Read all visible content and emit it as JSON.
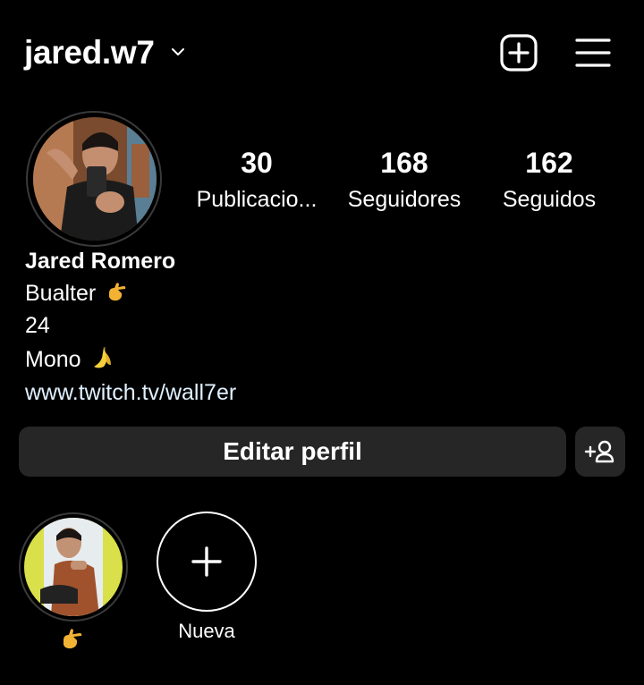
{
  "header": {
    "username": "jared.w7",
    "icons": [
      "chevron-down-icon",
      "plus-square-icon",
      "hamburger-menu-icon"
    ]
  },
  "stats": {
    "posts": {
      "value": "30",
      "label": "Publicacio..."
    },
    "followers": {
      "value": "168",
      "label": "Seguidores"
    },
    "following": {
      "value": "162",
      "label": "Seguidos"
    }
  },
  "profile": {
    "full_name": "Jared Romero",
    "bio_line1": "Bualter",
    "bio_line1_emoji": "pointing-hand-emoji",
    "bio_line2": "24",
    "bio_line3": "Mono",
    "bio_line3_emoji": "banana-emoji",
    "link": "www.twitch.tv/wall7er"
  },
  "actions": {
    "edit_profile_label": "Editar perfil",
    "add_friend_icon": "add-person-icon"
  },
  "highlights": {
    "items": [
      {
        "label_emoji": "pointing-hand-emoji"
      }
    ],
    "new_label": "Nueva"
  },
  "colors": {
    "background": "#000000",
    "button_bg": "#262626",
    "link": "#e0f1ff",
    "ring": "#3a3a3a"
  }
}
